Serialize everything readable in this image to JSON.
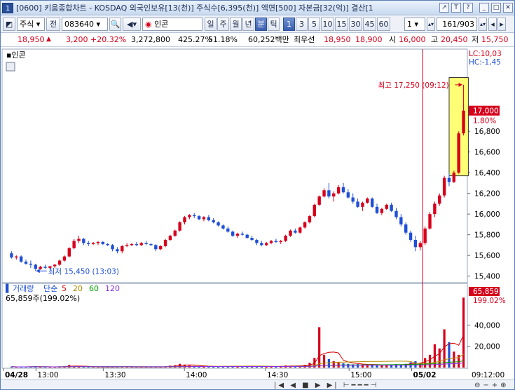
{
  "window": {
    "index": "1",
    "title": "[0600] 키움종합차트 - KOSDAQ 외국인보유[13(천)] 주식수[6,395(천)] 액면[500] 자본금[32(억)] 결산[1",
    "controls": [
      "↗",
      "T",
      "?",
      "_",
      "□",
      "✕"
    ]
  },
  "toolbar": {
    "chart_type_label": "주식",
    "prev_label": "전",
    "code": "083640",
    "stock_name": "인콘",
    "periods": [
      "일",
      "주",
      "월",
      "년",
      "분",
      "틱"
    ],
    "selected_period": "분",
    "intervals": [
      "1",
      "3",
      "5",
      "10",
      "15",
      "30",
      "45",
      "60"
    ],
    "selected_interval": "1",
    "count": "1",
    "page": "161/903"
  },
  "quote": {
    "price": "18,950",
    "change": "3,200",
    "change_pct": "+20.32%",
    "volume": "3,272,800",
    "vol_ratio": "425.27%",
    "foreign_ratio": "51.18%",
    "amount": "60,252백만",
    "best_bid_label": "최우선",
    "best_ask": "18,950",
    "best_bid": "18,900",
    "open_label": "시",
    "open": "16,000",
    "high_label": "고",
    "high": "20,450",
    "low_label": "저",
    "low": "15,750"
  },
  "colors": {
    "up": "#d6001c",
    "down": "#1f4fd6",
    "ma5": "#d60000",
    "ma20": "#b48c00",
    "ma60": "#00a000",
    "ma120": "#8a2be2",
    "highlight": "#ffff66"
  },
  "chart_data": {
    "type": "candlestick",
    "stock_label": "인콘",
    "ylim": [
      15350,
      17500
    ],
    "y_ticks": [
      "15,400",
      "15,600",
      "15,800",
      "16,000",
      "16,200",
      "16,400",
      "16,600",
      "16,800",
      "17,000"
    ],
    "high_marker": "최고 17,250 (09:12)",
    "low_marker": "최저 15,450 (13:03)",
    "lc_label": "LC:10,03",
    "hc_label": "HC:-1,45",
    "last_price": "17,000",
    "last_pct": "1.80%",
    "x_ticks": [
      {
        "label": "04/28",
        "bold": true,
        "x": 0
      },
      {
        "label": "13:00",
        "bold": false,
        "x": 0.07
      },
      {
        "label": "13:30",
        "bold": false,
        "x": 0.215
      },
      {
        "label": "14:00",
        "bold": false,
        "x": 0.39
      },
      {
        "label": "14:30",
        "bold": false,
        "x": 0.565
      },
      {
        "label": "15:00",
        "bold": false,
        "x": 0.745
      },
      {
        "label": "05/02",
        "bold": true,
        "x": 0.88
      }
    ],
    "x_end_label": "09:12:00",
    "candles": [
      [
        15620,
        15640,
        15570,
        15580
      ],
      [
        15580,
        15600,
        15560,
        15590
      ],
      [
        15590,
        15600,
        15530,
        15540
      ],
      [
        15540,
        15560,
        15510,
        15520
      ],
      [
        15520,
        15550,
        15480,
        15510
      ],
      [
        15510,
        15520,
        15450,
        15470
      ],
      [
        15470,
        15500,
        15460,
        15490
      ],
      [
        15490,
        15510,
        15470,
        15480
      ],
      [
        15480,
        15500,
        15470,
        15495
      ],
      [
        15495,
        15520,
        15480,
        15510
      ],
      [
        15510,
        15560,
        15500,
        15550
      ],
      [
        15550,
        15600,
        15540,
        15590
      ],
      [
        15590,
        15680,
        15580,
        15670
      ],
      [
        15670,
        15760,
        15660,
        15740
      ],
      [
        15740,
        15790,
        15720,
        15760
      ],
      [
        15760,
        15770,
        15700,
        15720
      ],
      [
        15720,
        15740,
        15690,
        15710
      ],
      [
        15710,
        15730,
        15700,
        15720
      ],
      [
        15720,
        15740,
        15700,
        15730
      ],
      [
        15730,
        15740,
        15700,
        15710
      ],
      [
        15710,
        15720,
        15690,
        15700
      ],
      [
        15700,
        15710,
        15640,
        15660
      ],
      [
        15660,
        15680,
        15620,
        15640
      ],
      [
        15640,
        15700,
        15620,
        15690
      ],
      [
        15690,
        15720,
        15680,
        15700
      ],
      [
        15700,
        15720,
        15690,
        15710
      ],
      [
        15710,
        15730,
        15690,
        15700
      ],
      [
        15700,
        15730,
        15690,
        15720
      ],
      [
        15720,
        15740,
        15700,
        15710
      ],
      [
        15710,
        15720,
        15690,
        15700
      ],
      [
        15700,
        15710,
        15640,
        15660
      ],
      [
        15660,
        15700,
        15650,
        15690
      ],
      [
        15690,
        15760,
        15680,
        15750
      ],
      [
        15750,
        15800,
        15740,
        15790
      ],
      [
        15790,
        15850,
        15780,
        15840
      ],
      [
        15840,
        15930,
        15830,
        15920
      ],
      [
        15920,
        15980,
        15900,
        15970
      ],
      [
        15970,
        16000,
        15950,
        15990
      ],
      [
        15990,
        16010,
        15960,
        15980
      ],
      [
        15980,
        15990,
        15940,
        15950
      ],
      [
        15950,
        15980,
        15930,
        15970
      ],
      [
        15970,
        15990,
        15930,
        15940
      ],
      [
        15940,
        15960,
        15910,
        15920
      ],
      [
        15920,
        15930,
        15880,
        15890
      ],
      [
        15890,
        15900,
        15850,
        15860
      ],
      [
        15860,
        15880,
        15820,
        15830
      ],
      [
        15830,
        15840,
        15780,
        15790
      ],
      [
        15790,
        15820,
        15770,
        15810
      ],
      [
        15810,
        15830,
        15790,
        15800
      ],
      [
        15800,
        15810,
        15760,
        15770
      ],
      [
        15770,
        15790,
        15740,
        15750
      ],
      [
        15750,
        15760,
        15700,
        15720
      ],
      [
        15720,
        15740,
        15690,
        15700
      ],
      [
        15700,
        15730,
        15690,
        15720
      ],
      [
        15720,
        15750,
        15710,
        15740
      ],
      [
        15740,
        15760,
        15720,
        15730
      ],
      [
        15730,
        15750,
        15710,
        15740
      ],
      [
        15740,
        15800,
        15730,
        15790
      ],
      [
        15790,
        15850,
        15780,
        15840
      ],
      [
        15840,
        15860,
        15810,
        15820
      ],
      [
        15820,
        15880,
        15810,
        15870
      ],
      [
        15870,
        15930,
        15860,
        15920
      ],
      [
        15920,
        15990,
        15910,
        15980
      ],
      [
        15980,
        16100,
        15970,
        16090
      ],
      [
        16090,
        16180,
        16080,
        16170
      ],
      [
        16170,
        16250,
        16160,
        16230
      ],
      [
        16230,
        16300,
        16150,
        16170
      ],
      [
        16170,
        16220,
        16120,
        16200
      ],
      [
        16200,
        16280,
        16190,
        16260
      ],
      [
        16260,
        16300,
        16200,
        16210
      ],
      [
        16210,
        16240,
        16150,
        16160
      ],
      [
        16160,
        16200,
        16100,
        16120
      ],
      [
        16120,
        16150,
        16060,
        16070
      ],
      [
        16070,
        16120,
        16030,
        16110
      ],
      [
        16110,
        16160,
        16100,
        16150
      ],
      [
        16150,
        16160,
        16060,
        16070
      ],
      [
        16070,
        16100,
        16000,
        16010
      ],
      [
        16010,
        16060,
        15990,
        16050
      ],
      [
        16050,
        16100,
        16040,
        16090
      ],
      [
        16090,
        16110,
        16020,
        16030
      ],
      [
        16030,
        16060,
        15950,
        15970
      ],
      [
        15970,
        16000,
        15880,
        15900
      ],
      [
        15900,
        15920,
        15800,
        15820
      ],
      [
        15820,
        15840,
        15730,
        15750
      ],
      [
        15750,
        15790,
        15640,
        15680
      ],
      [
        15680,
        15740,
        15650,
        15720
      ],
      [
        15720,
        15880,
        15700,
        15860
      ],
      [
        15860,
        16020,
        15850,
        16000
      ],
      [
        16000,
        16120,
        15970,
        16100
      ],
      [
        16100,
        16200,
        16080,
        16180
      ],
      [
        16180,
        16370,
        16160,
        16350
      ],
      [
        16350,
        16400,
        16270,
        16310
      ],
      [
        16310,
        16420,
        16300,
        16400
      ],
      [
        16400,
        16800,
        16390,
        16780
      ],
      [
        16780,
        17250,
        16760,
        17000
      ]
    ],
    "volume_panel": {
      "legend_label": "거래량",
      "ma_type": "단순",
      "ma_periods": [
        "5",
        "20",
        "60",
        "120"
      ],
      "current_volume": "65,859주(199.02%)",
      "right_value": "65,859",
      "right_pct": "199.02%",
      "ylim": [
        0,
        70000
      ],
      "y_ticks": [
        "20,000",
        "40,000"
      ],
      "volumes": [
        800,
        500,
        700,
        600,
        900,
        1200,
        500,
        400,
        600,
        700,
        900,
        1200,
        2500,
        1500,
        900,
        600,
        500,
        500,
        400,
        500,
        600,
        700,
        800,
        600,
        500,
        400,
        500,
        600,
        500,
        400,
        600,
        700,
        1200,
        1800,
        2200,
        3500,
        2800,
        1900,
        1500,
        1200,
        1000,
        900,
        900,
        1100,
        1000,
        1300,
        1100,
        800,
        900,
        900,
        1000,
        1200,
        900,
        800,
        900,
        1100,
        1500,
        2000,
        1600,
        1200,
        1800,
        2600,
        4500,
        9000,
        38000,
        12000,
        8000,
        6000,
        5000,
        4000,
        3500,
        3000,
        3200,
        2800,
        2500,
        3000,
        2600,
        2400,
        2200,
        2800,
        3200,
        2600,
        3500,
        5000,
        6000,
        4000,
        9000,
        12000,
        22000,
        18000,
        36000,
        24000,
        15000,
        12000,
        65859
      ]
    }
  }
}
